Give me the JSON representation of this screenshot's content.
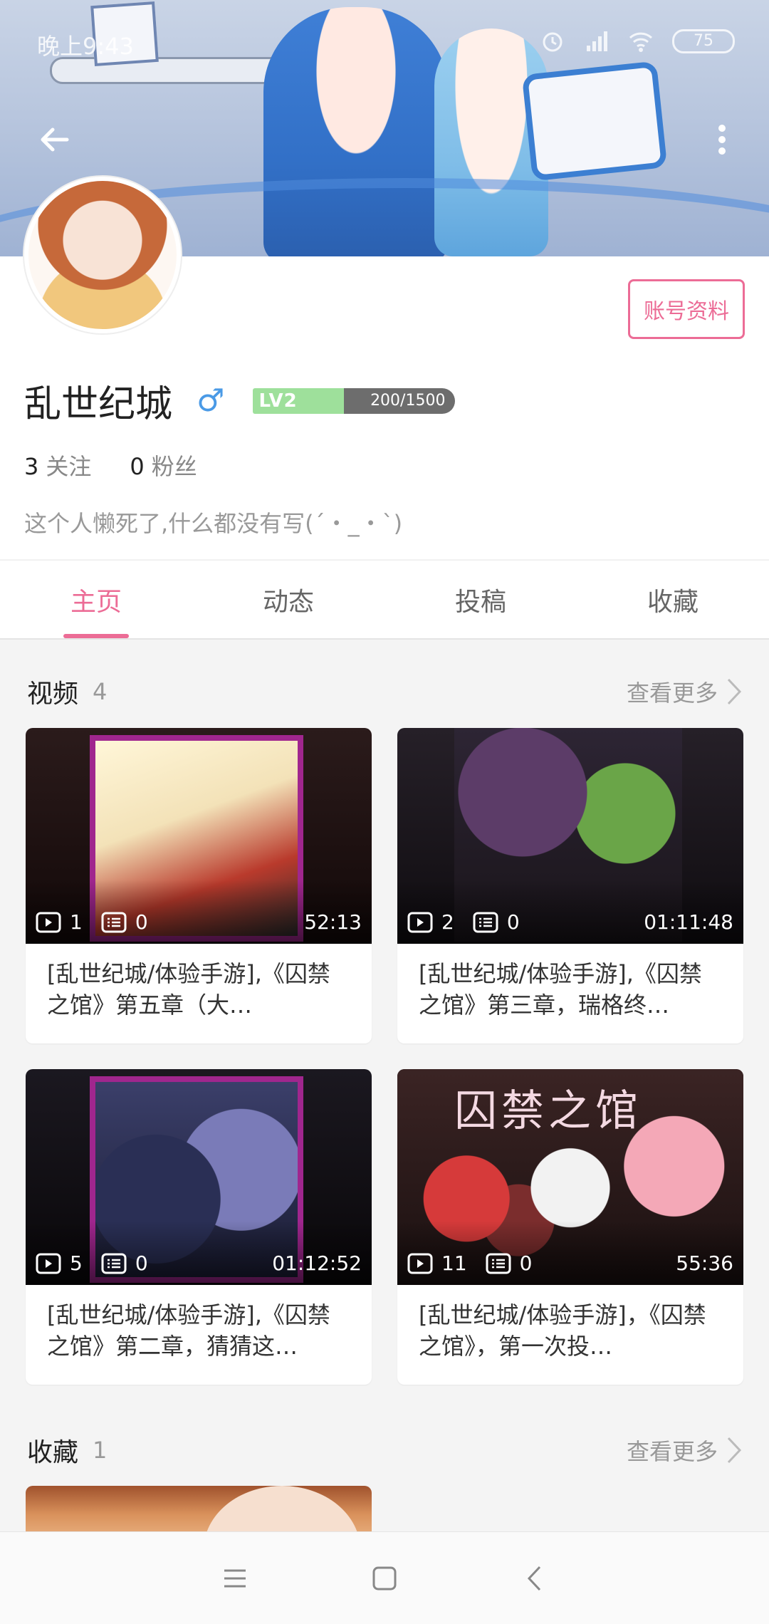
{
  "status_bar": {
    "time": "晚上9:43",
    "battery": "75"
  },
  "profile": {
    "name": "乱世纪城",
    "gender_symbol": "♂",
    "level_badge": "LV2",
    "level_progress_text": "200/1500",
    "level_progress_fraction": 0.1333,
    "account_button": "账号资料",
    "following_count": "3",
    "following_label": "关注",
    "followers_count": "0",
    "followers_label": "粉丝",
    "bio": "这个人懒死了,什么都没有写(´・_・`)"
  },
  "tabs": [
    {
      "label": "主页",
      "active": true
    },
    {
      "label": "动态",
      "active": false
    },
    {
      "label": "投稿",
      "active": false
    },
    {
      "label": "收藏",
      "active": false
    }
  ],
  "videos_section": {
    "title": "视频",
    "count": "4",
    "see_more": "查看更多",
    "items": [
      {
        "plays": "1",
        "comments": "0",
        "duration": "52:13",
        "title": "[乱世纪城/体验手游],《囚禁之馆》第五章（大…"
      },
      {
        "plays": "2",
        "comments": "0",
        "duration": "01:11:48",
        "title": "[乱世纪城/体验手游],《囚禁之馆》第三章，瑞格终…"
      },
      {
        "plays": "5",
        "comments": "0",
        "duration": "01:12:52",
        "title": "[乱世纪城/体验手游],《囚禁之馆》第二章，猜猜这…"
      },
      {
        "plays": "11",
        "comments": "0",
        "duration": "55:36",
        "title": "[乱世纪城/体验手游]，《囚禁之馆》，第一次投…",
        "thumb_text": "囚禁之馆"
      }
    ]
  },
  "favorites_section": {
    "title": "收藏",
    "count": "1",
    "see_more": "查看更多"
  },
  "colors": {
    "accent": "#ec6c96",
    "male_blue": "#4a9ae6",
    "level_green": "#9ee09b"
  }
}
